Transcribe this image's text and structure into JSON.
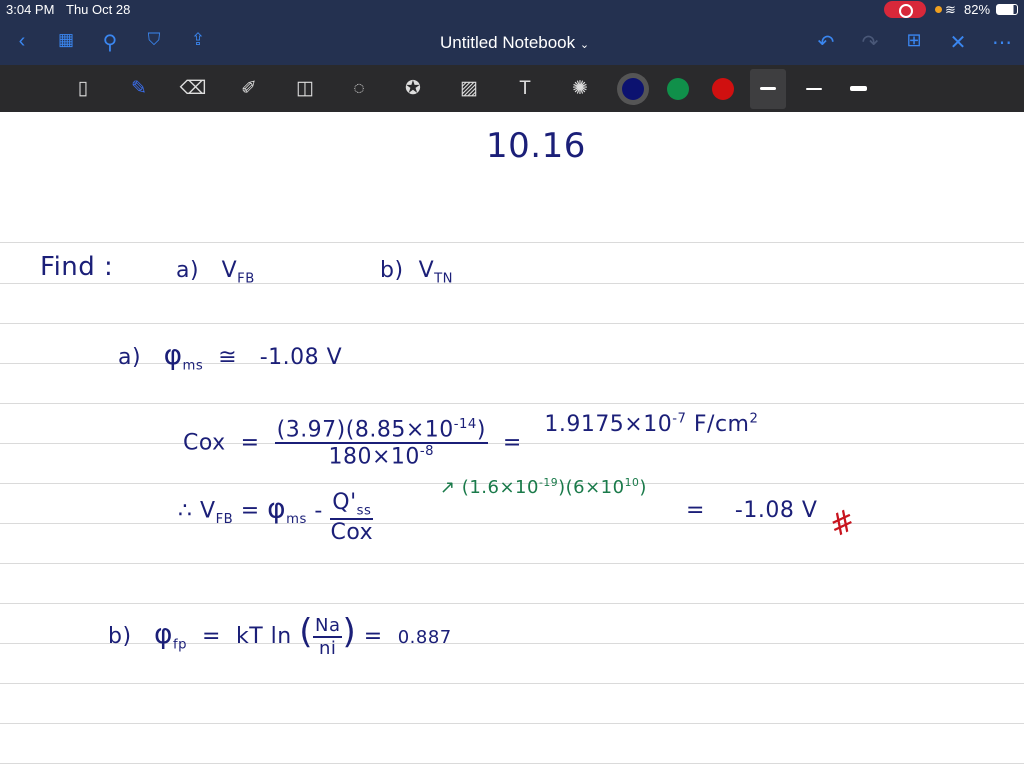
{
  "status": {
    "time": "3:04 PM",
    "date": "Thu Oct 28",
    "battery": "82%"
  },
  "header": {
    "title": "Untitled Notebook",
    "title_chevron": "⌄"
  },
  "nav_icons": [
    "back-icon",
    "grid-icon",
    "search-icon",
    "bookmark-icon",
    "share-icon"
  ],
  "right_icons": [
    "undo-icon",
    "redo-icon",
    "add-page-icon",
    "close-icon",
    "more-icon"
  ],
  "tools": [
    "read-mode",
    "pen",
    "eraser",
    "highlighter",
    "shapes",
    "lasso",
    "elements",
    "image",
    "text",
    "laser"
  ],
  "colors": [
    "#0c1270",
    "#10904a",
    "#d01010"
  ],
  "page": {
    "heading": "10.16",
    "find": "Find :",
    "fa_label": "a)",
    "fa_var": "V",
    "fa_sub": "FB",
    "fb_label": "b)",
    "fb_var": "V",
    "fb_sub": "TN",
    "a_label": "a)",
    "phi": "φ",
    "ms": "ms",
    "approx": "≅",
    "phi_val": "-1.08 V",
    "cox": "Cox",
    "eq": "=",
    "cox_num": "(3.97)(8.85×10",
    "cox_num_exp": "-14",
    "cox_num_end": ")",
    "cox_den": "180×10",
    "cox_den_exp": "-8",
    "cox_res": "1.9175×10",
    "cox_res_exp": "-7",
    "cox_unit": "F/cm",
    "cox_unit_exp": "2",
    "therefore": "∴",
    "vfb": "V",
    "vfb_sub": "FB",
    "minus": "-",
    "qss": "Q'",
    "qss_sub": "ss",
    "cox_den2": "Cox",
    "green": "↗ (1.6×10",
    "green_exp1": "-19",
    "green_mid": ")(6×10",
    "green_exp2": "10",
    "green_end": ")",
    "vfb_res": "-1.08 V",
    "red_mark": "#",
    "b_label": "b)",
    "fp": "fp",
    "kt": "kT ln",
    "na": "Na",
    "ni": "ni",
    "fp_res": "0.887"
  }
}
